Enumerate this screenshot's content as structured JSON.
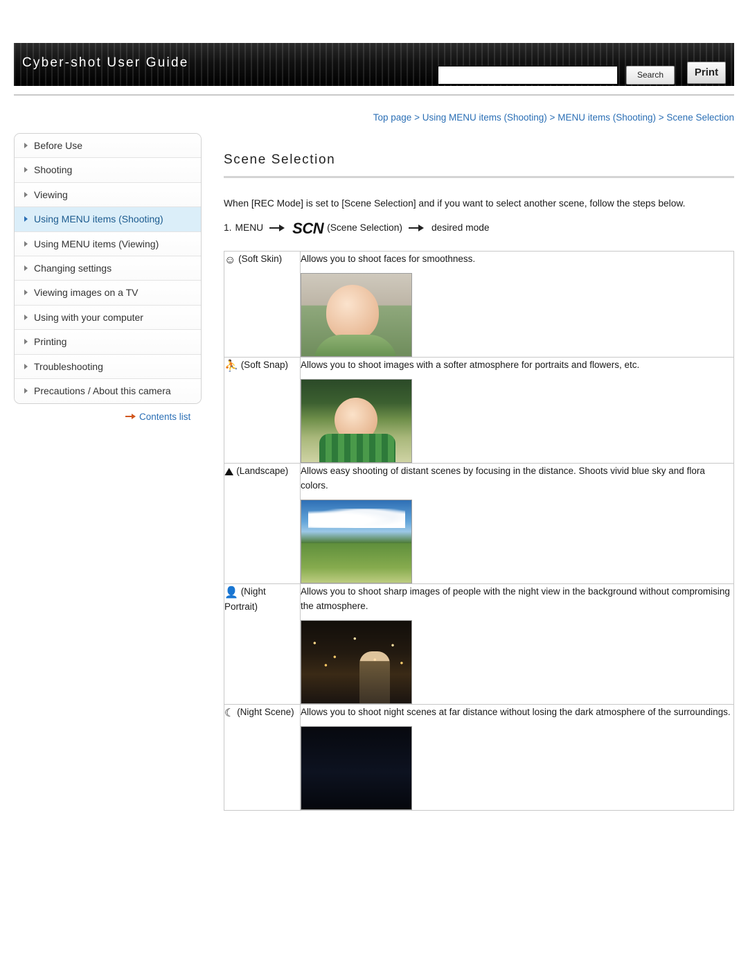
{
  "header": {
    "title": "Cyber-shot User Guide",
    "search_value": "",
    "search_placeholder": "",
    "search_button": "Search",
    "print_button": "Print"
  },
  "breadcrumb": {
    "items": [
      "Top page",
      "Using MENU items (Shooting)",
      "MENU items (Shooting)",
      "Scene Selection"
    ],
    "separator": ">"
  },
  "sidebar": {
    "items": [
      {
        "label": "Before Use",
        "active": false
      },
      {
        "label": "Shooting",
        "active": false
      },
      {
        "label": "Viewing",
        "active": false
      },
      {
        "label": "Using MENU items (Shooting)",
        "active": true
      },
      {
        "label": "Using MENU items (Viewing)",
        "active": false
      },
      {
        "label": "Changing settings",
        "active": false
      },
      {
        "label": "Viewing images on a TV",
        "active": false
      },
      {
        "label": "Using with your computer",
        "active": false
      },
      {
        "label": "Printing",
        "active": false
      },
      {
        "label": "Troubleshooting",
        "active": false
      },
      {
        "label": "Precautions / About this camera",
        "active": false
      }
    ],
    "contents_list": "Contents list"
  },
  "main": {
    "page_title": "Scene Selection",
    "intro": "When [REC Mode] is set to [Scene Selection] and if you want to select another scene, follow the steps below.",
    "step": {
      "number": "1.",
      "menu_label": "MENU",
      "scn_badge": "SCN",
      "scn_caption": "(Scene Selection)",
      "tail": "desired mode"
    },
    "rows": [
      {
        "icon_glyph": "☺",
        "icon_name": "soft-skin-icon",
        "label": "(Soft Skin)",
        "description": "Allows you to shoot faces for smoothness.",
        "thumb_class": "t-soft-skin",
        "thumb_name": "soft-skin-sample-photo"
      },
      {
        "icon_glyph": "⛹",
        "icon_name": "soft-snap-icon",
        "label": "(Soft Snap)",
        "description": "Allows you to shoot images with a softer atmosphere for portraits and flowers, etc.",
        "thumb_class": "t-soft-snap",
        "thumb_name": "soft-snap-sample-photo"
      },
      {
        "icon_glyph": "⛰",
        "icon_name": "landscape-icon",
        "label": "(Landscape)",
        "description": "Allows easy shooting of distant scenes by focusing in the distance. Shoots vivid blue sky and flora colors.",
        "thumb_class": "t-landscape",
        "thumb_name": "landscape-sample-photo"
      },
      {
        "icon_glyph": "👤",
        "icon_name": "night-portrait-icon",
        "label": "(Night Portrait)",
        "description": "Allows you to shoot sharp images of people with the night view in the background without compromising the atmosphere.",
        "thumb_class": "t-night-portrait",
        "thumb_name": "night-portrait-sample-photo"
      },
      {
        "icon_glyph": "☾",
        "icon_name": "night-scene-icon",
        "label": "(Night Scene)",
        "description": "Allows you to shoot night scenes at far distance without losing the dark atmosphere of the surroundings.",
        "thumb_class": "t-night-scene",
        "thumb_name": "night-scene-sample-photo"
      }
    ]
  },
  "colors": {
    "link": "#2b6fb5",
    "active_sidebar_bg": "#dbeef9",
    "header_bg": "#000000",
    "contents_arrow": "#d1581f"
  }
}
